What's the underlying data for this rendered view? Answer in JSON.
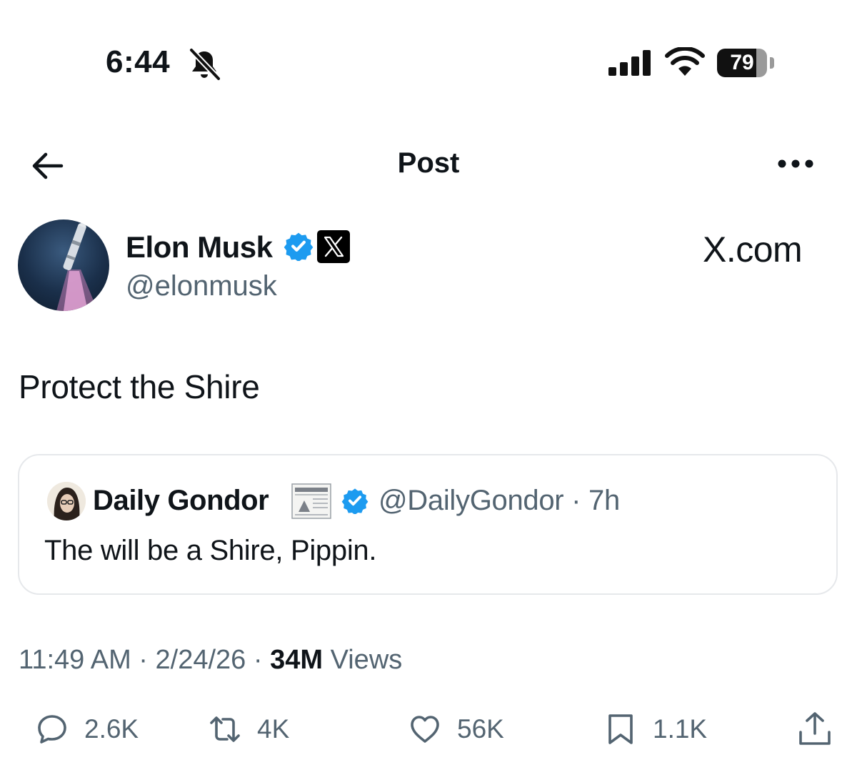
{
  "status_bar": {
    "time": "6:44",
    "battery_percent": "79",
    "battery_level": 0.79,
    "icons": [
      "bell-slash-icon",
      "cellular-signal-icon",
      "wifi-icon",
      "battery-icon"
    ]
  },
  "nav": {
    "title": "Post",
    "back_icon": "arrow-left-icon",
    "more_icon": "more-horizontal-icon"
  },
  "author": {
    "name": "Elon Musk",
    "handle": "@elonmusk",
    "affiliation": "X.com",
    "verified_color": "#1d9bf0"
  },
  "post": {
    "text": "Protect the Shire"
  },
  "quote": {
    "name": "Daily Gondor",
    "handle": "@DailyGondor",
    "time": "7h",
    "text": "The will be a Shire, Pippin."
  },
  "meta": {
    "time": "11:49 AM",
    "date": "2/24/26",
    "views_count": "34M",
    "views_label": "Views"
  },
  "actions": {
    "replies": "2.6K",
    "reposts": "4K",
    "likes": "56K",
    "bookmarks": "1.1K"
  },
  "colors": {
    "text_primary": "#0f1419",
    "text_secondary": "#536471",
    "accent": "#1d9bf0",
    "border": "#e6e8eb"
  }
}
